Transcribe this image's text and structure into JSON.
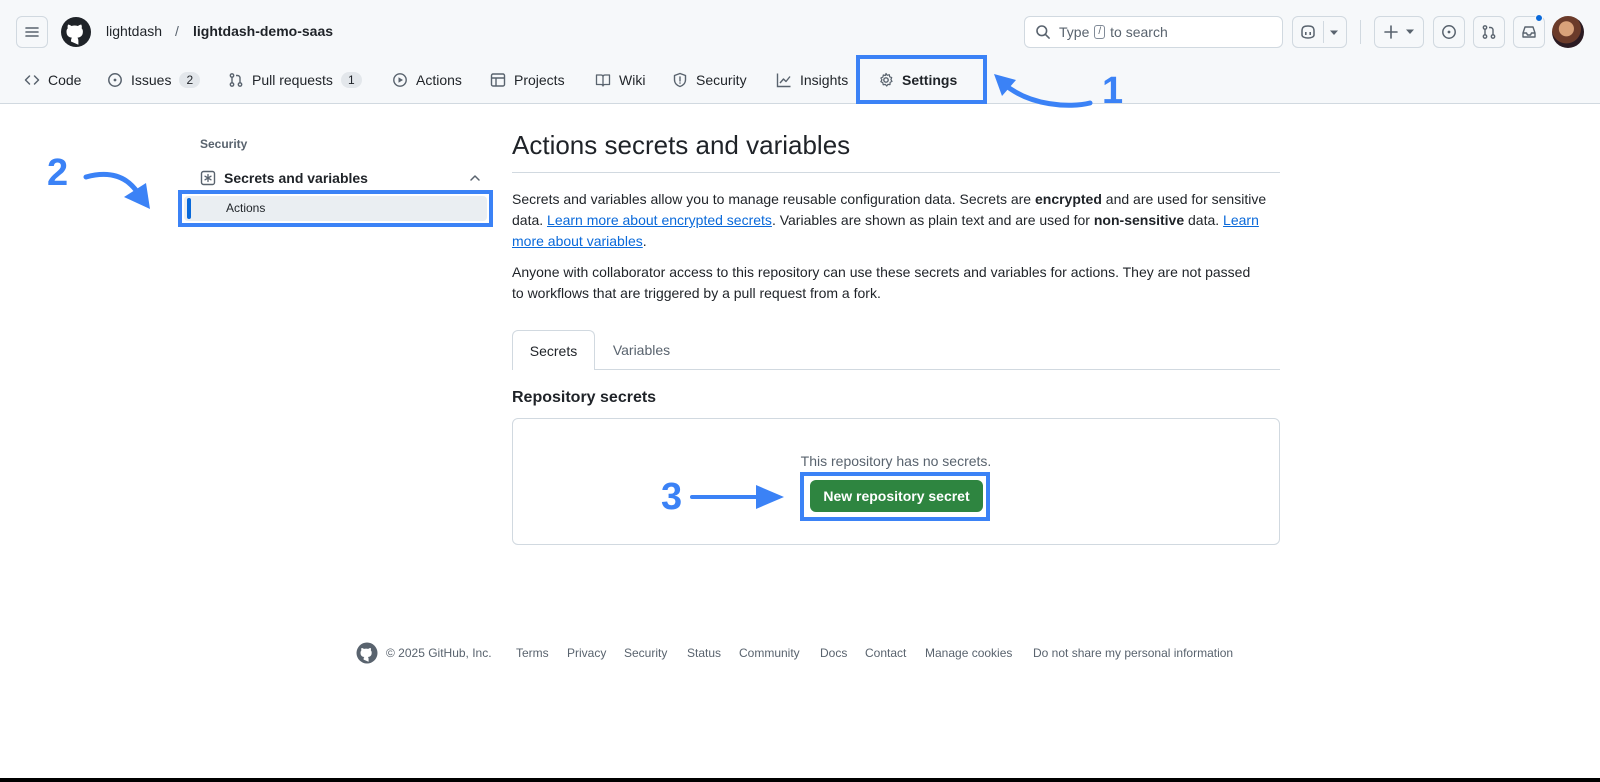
{
  "header": {
    "owner": "lightdash",
    "separator": "/",
    "repo": "lightdash-demo-saas",
    "search": {
      "prefix": "Type",
      "key": "/",
      "suffix": "to search"
    }
  },
  "tabs": [
    {
      "label": "Code",
      "icon": "code-icon"
    },
    {
      "label": "Issues",
      "icon": "issue-opened-icon",
      "count": "2"
    },
    {
      "label": "Pull requests",
      "icon": "git-pull-request-icon",
      "count": "1"
    },
    {
      "label": "Actions",
      "icon": "play-icon"
    },
    {
      "label": "Projects",
      "icon": "table-icon"
    },
    {
      "label": "Wiki",
      "icon": "book-icon"
    },
    {
      "label": "Security",
      "icon": "shield-icon"
    },
    {
      "label": "Insights",
      "icon": "graph-icon"
    },
    {
      "label": "Settings",
      "icon": "gear-icon",
      "selected": true
    }
  ],
  "sidebar": {
    "section_title": "Security",
    "group_label": "Secrets and variables",
    "sub_item": "Actions"
  },
  "main": {
    "title": "Actions secrets and variables",
    "intro": {
      "t1": "Secrets and variables allow you to manage reusable configuration data. Secrets are ",
      "b1": "encrypted",
      "t2": " and are used for sensitive data. ",
      "link1": "Learn more about encrypted secrets",
      "t3": ". Variables are shown as plain text and are used for ",
      "b2": "non-sensitive",
      "t4": " data. ",
      "link2": "Learn more about variables",
      "t5": "."
    },
    "note": "Anyone with collaborator access to this repository can use these secrets and variables for actions. They are not passed to workflows that are triggered by a pull request from a fork.",
    "tabs": [
      {
        "label": "Secrets",
        "selected": true
      },
      {
        "label": "Variables"
      }
    ],
    "section_heading": "Repository secrets",
    "empty_text": "This repository has no secrets.",
    "new_button": "New repository secret"
  },
  "annotations": {
    "one": "1",
    "two": "2",
    "three": "3",
    "color": "#3b82f6"
  },
  "footer": {
    "copyright": "© 2025 GitHub, Inc.",
    "links": [
      "Terms",
      "Privacy",
      "Security",
      "Status",
      "Community",
      "Docs",
      "Contact",
      "Manage cookies",
      "Do not share my personal information"
    ]
  }
}
